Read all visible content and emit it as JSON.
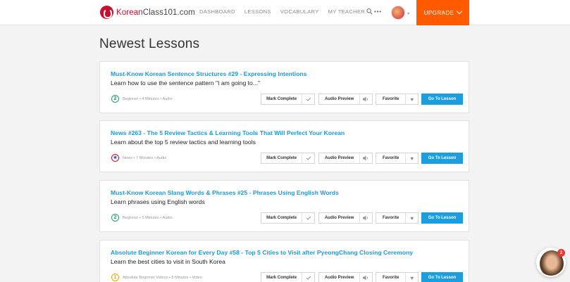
{
  "header": {
    "logo_brand": "Korean",
    "logo_rest": "Class101.com",
    "nav": [
      "DASHBOARD",
      "LESSONS",
      "VOCABULARY",
      "MY TEACHER"
    ],
    "more": "•••",
    "upgrade_label": "UPGRADE"
  },
  "page_title": "Newest Lessons",
  "buttons": {
    "mark_complete": "Mark Complete",
    "audio_preview": "Audio Preview",
    "favorite": "Favorite",
    "go": "Go To Lesson"
  },
  "lessons": [
    {
      "title": "Must-Know Korean Sentence Structures #29 - Expressing Intentions",
      "description": "Learn how to use the sentence pattern \"I am going to...\"",
      "badge": "2",
      "meta": "Beginner • 4 Minutes • Audio"
    },
    {
      "title": "News #263 - The 5 Review Tactics & Learning Tools That Will Perfect Your Korean",
      "description": "Learn about the top 5 review tactics and learning tools",
      "badge": "★",
      "meta": "News • 7 Minutes • Audio"
    },
    {
      "title": "Must-Know Korean Slang Words & Phrases #25 - Phrases Using English Words",
      "description": "Learn phrases using English words",
      "badge": "2",
      "meta": "Beginner • 5 Minutes • Audio"
    },
    {
      "title": "Absolute Beginner Korean for Every Day #58 - Top 5 Cities to Visit after PyeongChang Closing Ceremony",
      "description": "Learn the best cities to visit in South Korea",
      "badge": "1",
      "meta": "Absolute Beginner Videos • 8 Minutes • Video"
    }
  ],
  "chat": {
    "badge_count": "2"
  },
  "colors": {
    "accent": "#ff5a00",
    "link": "#1e9ad6",
    "go_button": "#1a9ee0"
  }
}
